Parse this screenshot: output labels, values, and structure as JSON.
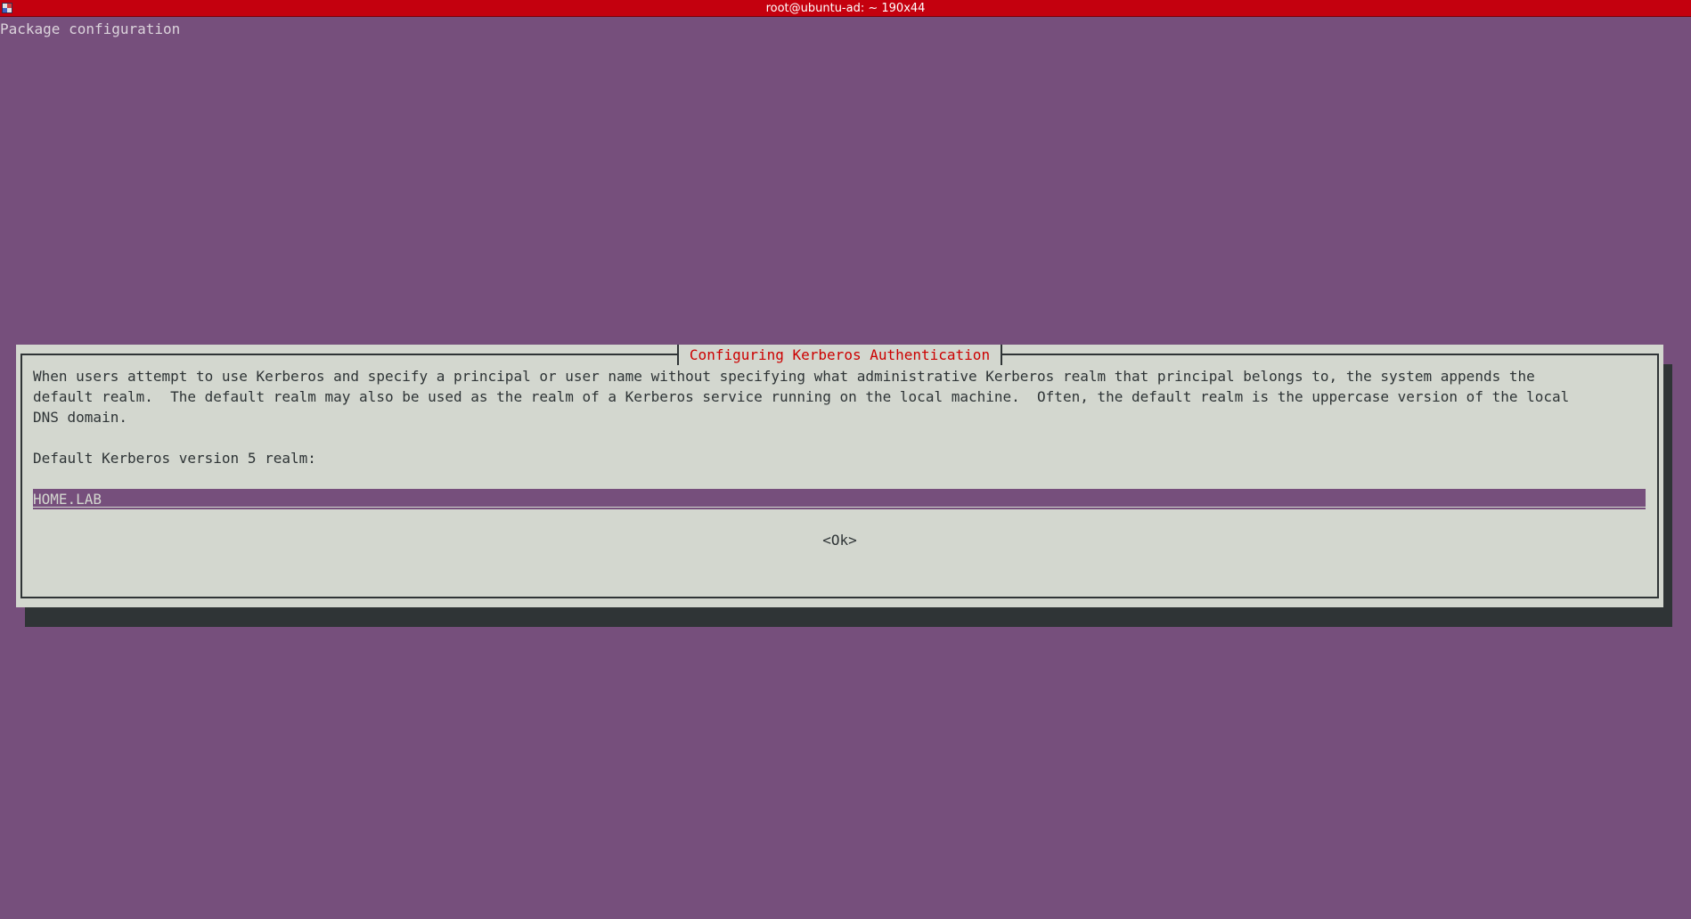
{
  "window": {
    "title": "root@ubuntu-ad: ~ 190x44",
    "icon": "terminal-app-icon"
  },
  "terminal": {
    "header": "Package configuration"
  },
  "dialog": {
    "title": "Configuring Kerberos Authentication",
    "description": "When users attempt to use Kerberos and specify a principal or user name without specifying what administrative Kerberos realm that principal belongs to, the system appends the\ndefault realm.  The default realm may also be used as the realm of a Kerberos service running on the local machine.  Often, the default realm is the uppercase version of the local\nDNS domain.",
    "prompt": "Default Kerberos version 5 realm:",
    "input_value": "HOME.LAB",
    "ok_label": "<Ok>"
  },
  "colors": {
    "titlebar": "#c4000e",
    "background": "#764f7c",
    "dialog": "#d3d7cf",
    "dialog_title": "#cc0000",
    "shadow": "#2f3436"
  }
}
